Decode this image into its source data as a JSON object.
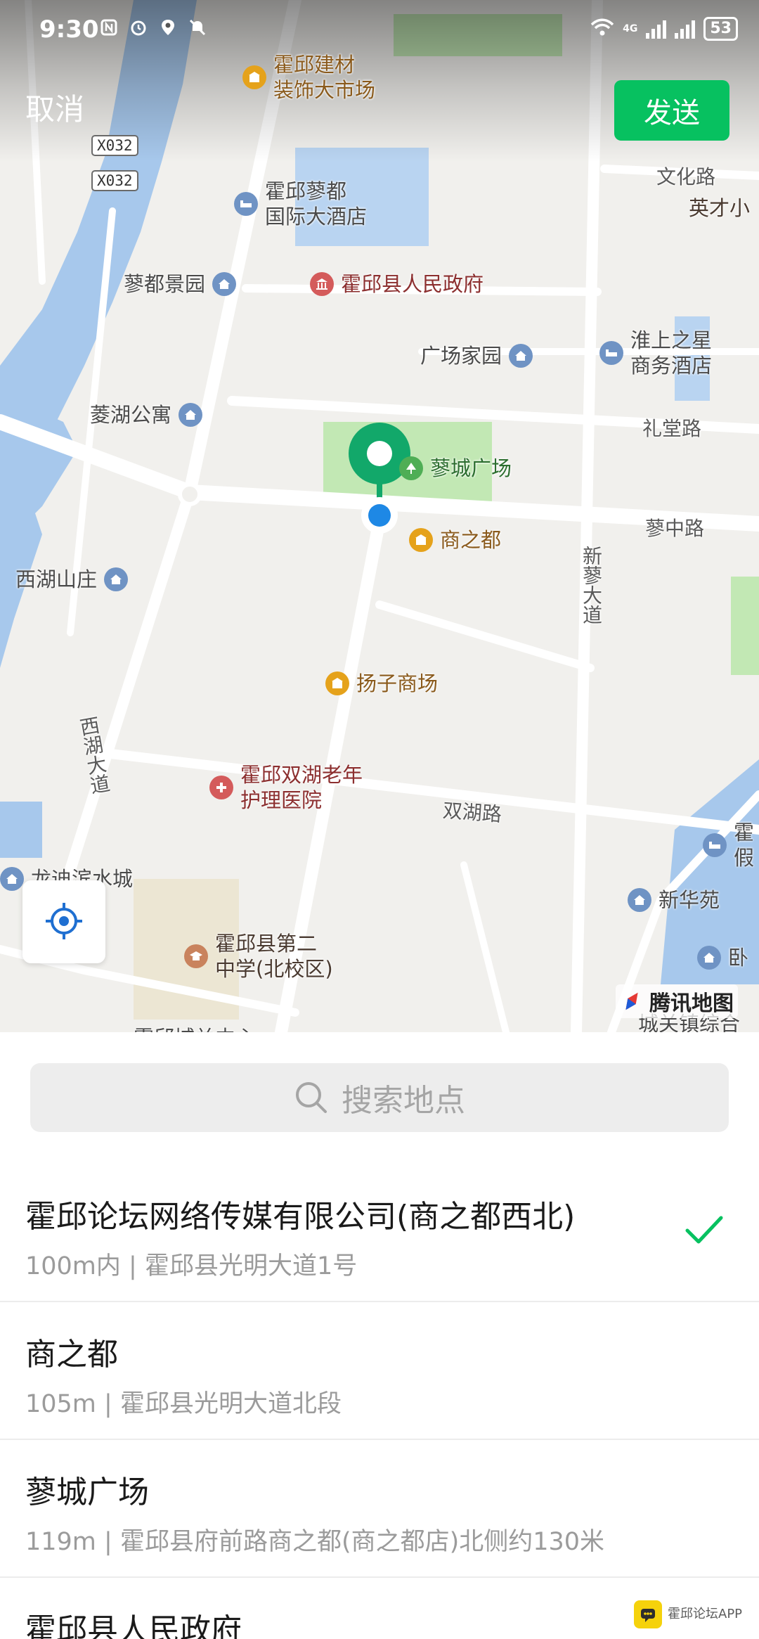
{
  "status_bar": {
    "time": "9:30",
    "battery": "53",
    "network": "4G"
  },
  "header": {
    "cancel_label": "取消",
    "send_label": "发送"
  },
  "map": {
    "road_badges": [
      "X032",
      "X032"
    ],
    "pois": {
      "building_market": "霍邱建材\n装饰大市场",
      "hotel": "霍邱蓼都\n国际大酒店",
      "liaodu_garden": "蓼都景园",
      "gov": "霍邱县人民政府",
      "guangchang_home": "广场家园",
      "huaishang_hotel": "淮上之星\n商务酒店",
      "linghu": "菱湖公寓",
      "liaocheng_square": "蓼城广场",
      "shangzhidu": "商之都",
      "xihu": "西湖山庄",
      "yangzi": "扬子商场",
      "nursing": "霍邱双湖老年\n护理医院",
      "longdi": "龙迪滨水城",
      "xinhua": "新华苑",
      "school": "霍邱县第二\n中学(北校区)",
      "yingcai": "英才小",
      "right_edge_huo": "霍\n假",
      "wo": "卧",
      "chengguan": "城关镇综合",
      "bottom_cut": "霍邱城关中心"
    },
    "roads": {
      "wenhua": "文化路",
      "litang": "礼堂路",
      "liaozhong": "蓼中路",
      "xinliao": "新蓼大道",
      "xihu_road": "西湖大道",
      "shuanghu": "双湖路"
    },
    "logo_text": "腾讯地图"
  },
  "search": {
    "placeholder": "搜索地点"
  },
  "results": [
    {
      "name": "霍邱论坛网络传媒有限公司(商之都西北)",
      "address": "100m内 | 霍邱县光明大道1号",
      "selected": true
    },
    {
      "name": "商之都",
      "address": "105m | 霍邱县光明大道北段",
      "selected": false
    },
    {
      "name": "蓼城广场",
      "address": "119m | 霍邱县府前路商之都(商之都店)北侧约130米",
      "selected": false
    },
    {
      "name": "霍邱县人民政府",
      "address": "",
      "selected": false
    }
  ],
  "watermark": "霍邱论坛APP",
  "colors": {
    "accent": "#07c160",
    "pin": "#12a86a",
    "water": "#a7c8ec",
    "park": "#c2e8b4"
  }
}
